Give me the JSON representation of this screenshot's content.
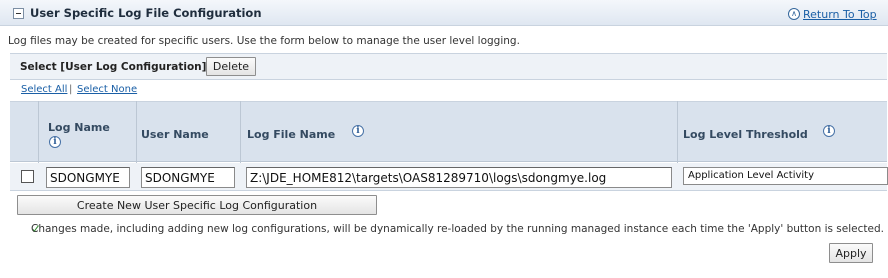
{
  "section": {
    "title": "User Specific Log File Configuration",
    "return_to_top": "Return To Top",
    "description": "Log files may be created for specific users. Use the form below to manage the user level logging."
  },
  "selection": {
    "label": "Select [User Log Configuration]:",
    "delete_label": "Delete",
    "select_all": "Select All",
    "separator": "|",
    "select_none": "Select None"
  },
  "table": {
    "columns": {
      "log_name": "Log Name",
      "user_name": "User Name",
      "log_file_name": "Log File Name",
      "log_level_threshold": "Log Level Threshold"
    },
    "rows": [
      {
        "selected": false,
        "log_name": "SDONGMYE",
        "user_name": "SDONGMYE",
        "log_file_name": "Z:\\JDE_HOME812\\targets\\OAS81289710\\logs\\sdongmye.log",
        "log_level_threshold": "Application Level Activity"
      }
    ]
  },
  "create_button_label": "Create New User Specific Log Configuration",
  "note": "Changes made, including adding new log configurations, will be dynamically re-loaded by the running managed instance each time the 'Apply' button is selected.",
  "apply_label": "Apply",
  "icons": {
    "collapse": "minus-box-icon",
    "return_to_top": "up-arrow-circle-icon",
    "info": "info-icon",
    "note": "checkmark-icon"
  },
  "colors": {
    "header_bg": "#dfe7f1",
    "table_header_bg": "#d9e2ed",
    "link": "#1a5fa6",
    "info_icon": "#2b5b95",
    "note_check": "#2f8a2f"
  }
}
